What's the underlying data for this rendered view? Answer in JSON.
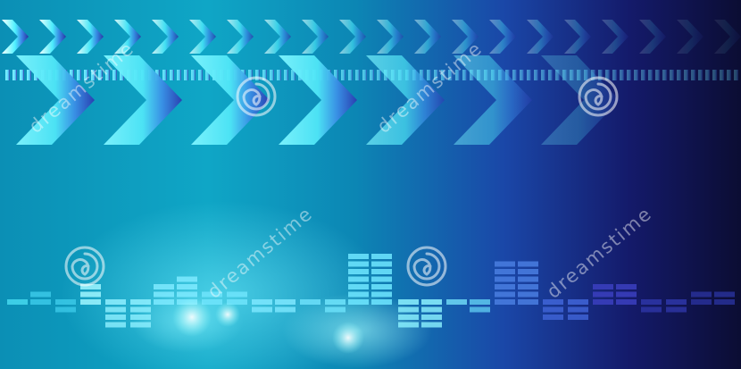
{
  "image": {
    "watermark_text": "dreamstime",
    "palette": {
      "cyan": "#3ee8f5",
      "teal": "#1bb7d6",
      "blue": "#2a5fd0",
      "indigo": "#2a2fa0",
      "navy": "#0b0d33",
      "white": "#ffffff"
    },
    "icons": [
      "chevron-right-icon",
      "spiral-logo-icon"
    ]
  }
}
